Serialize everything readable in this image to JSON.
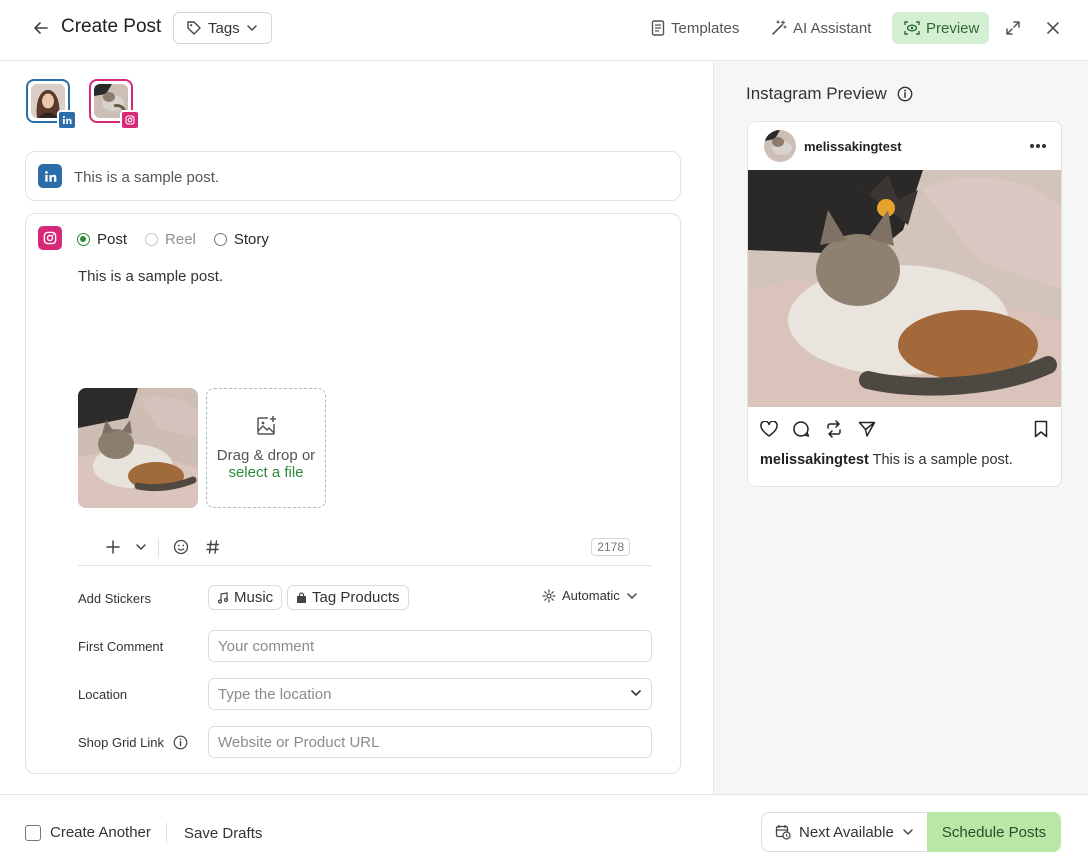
{
  "header": {
    "title": "Create Post",
    "tags_label": "Tags",
    "templates_label": "Templates",
    "ai_label": "AI Assistant",
    "preview_label": "Preview"
  },
  "colors": {
    "accent_green": "#2e8a3a",
    "preview_bg": "#d5efd3",
    "schedule_bg": "#b9e7a6",
    "linkedin": "#2b6da8",
    "instagram": "#d6297a"
  },
  "linkedin": {
    "text": "This is a sample post.",
    "icon": "linkedin-icon"
  },
  "instagram": {
    "icon": "instagram-icon",
    "types": [
      "Post",
      "Reel",
      "Story"
    ],
    "selected_type": "Post",
    "text": "This is a sample post.",
    "drop": {
      "line1": "Drag & drop or",
      "link": "select a file"
    },
    "char_count": "2178",
    "stickers_label": "Add Stickers",
    "music_label": "Music",
    "tag_products_label": "Tag Products",
    "automatic_label": "Automatic",
    "first_comment_label": "First Comment",
    "first_comment_placeholder": "Your comment",
    "location_label": "Location",
    "location_placeholder": "Type the location",
    "shop_label": "Shop Grid Link",
    "shop_placeholder": "Website or Product URL"
  },
  "preview": {
    "title": "Instagram Preview",
    "username": "melissakingtest",
    "caption": "This is a sample post."
  },
  "footer": {
    "create_another": "Create Another",
    "save_drafts": "Save Drafts",
    "next_available": "Next Available",
    "schedule": "Schedule Posts"
  }
}
